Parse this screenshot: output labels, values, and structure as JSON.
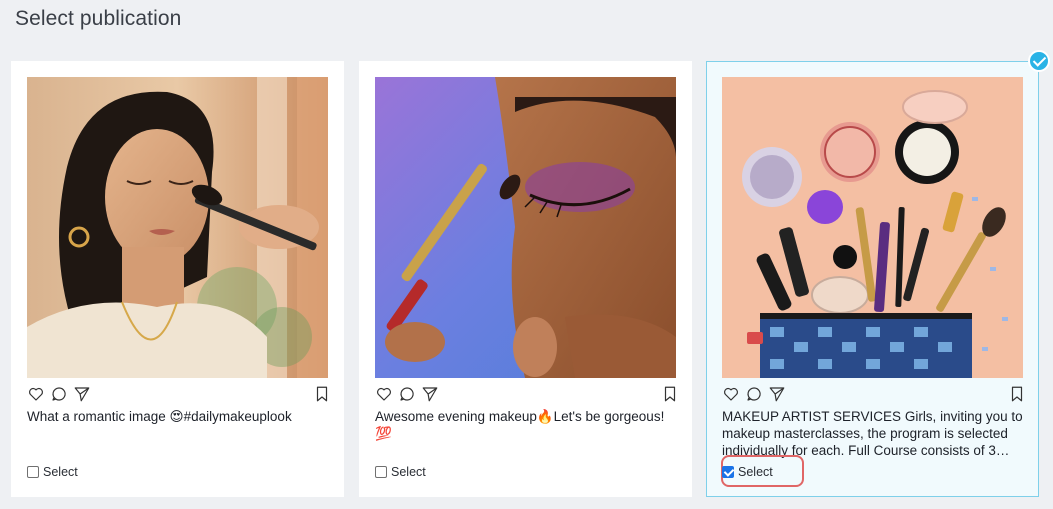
{
  "page": {
    "title": "Select publication"
  },
  "posts": [
    {
      "caption": "What a romantic image 😍#dailymakeuplook",
      "select_label": "Select",
      "selected": false,
      "image_icon": "portrait-makeup-brush-image"
    },
    {
      "caption": "Awesome evening makeup🔥Let's be gorgeous! 💯",
      "select_label": "Select",
      "selected": false,
      "image_icon": "eyeshadow-closeup-image"
    },
    {
      "caption": "MAKEUP ARTIST SERVICES Girls, inviting you to makeup masterclasses, the program is selected individually for each. Full Course consists of 3…",
      "select_label": "Select",
      "selected": true,
      "image_icon": "makeup-flatlay-image"
    }
  ],
  "icons": [
    "heart-icon",
    "comment-icon",
    "share-icon",
    "bookmark-icon",
    "checkmark-icon"
  ],
  "colors": {
    "background": "#eef0f3",
    "selected_border": "#7fd0ea",
    "selected_badge": "#2ab3e6",
    "highlight": "#e06666",
    "checkbox_checked": "#1a73e8"
  }
}
